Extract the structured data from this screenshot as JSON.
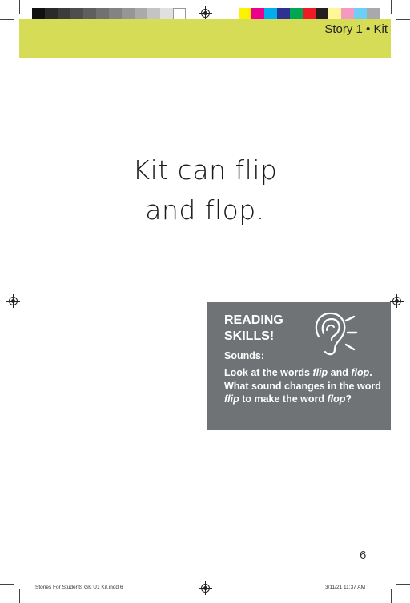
{
  "header": {
    "story_label": "Story 1 • Kit"
  },
  "main": {
    "line1": "Kit can flip",
    "line2": "and flop."
  },
  "skills": {
    "title_line1": "READING",
    "title_line2": "SKILLS!",
    "sounds_label": "Sounds:",
    "body_part1": "Look at the words ",
    "word_flip": "flip",
    "body_part2": " and ",
    "word_flop": "flop",
    "body_part3": ". What sound changes in the word ",
    "word_flip2": "flip",
    "body_part4": " to make the word ",
    "word_flop2": "flop",
    "body_part5": "?",
    "icon": "ear-icon"
  },
  "page_number": "6",
  "slug": {
    "file": "Stories For Students GK U1 Kit.indd   6",
    "datetime": "3/11/21   11:37 AM"
  },
  "colors": {
    "header_band": "#d6dc55",
    "skills_box": "#707375",
    "gray_bar": [
      "#111111",
      "#2a2a2a",
      "#3c3c3c",
      "#4e4e4e",
      "#5f5f5f",
      "#717171",
      "#838383",
      "#969696",
      "#aaaaaa",
      "#c4c4c4",
      "#e0e0e0",
      "#ffffff"
    ],
    "color_bar": [
      "#fff200",
      "#ec008c",
      "#00aeef",
      "#2e3192",
      "#00a651",
      "#ed1c24",
      "#231f20",
      "#fff799",
      "#f49ac1",
      "#6dcff6",
      "#a7a9ac"
    ]
  }
}
